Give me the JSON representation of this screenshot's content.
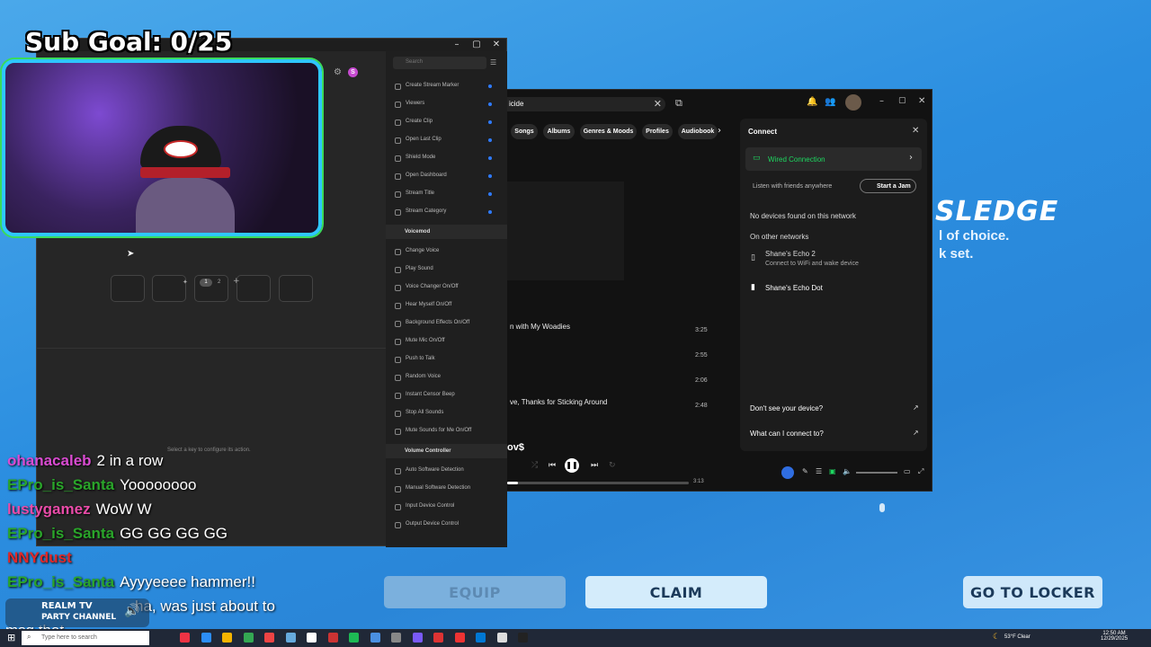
{
  "overlay": {
    "sub_goal": "Sub Goal: 0/25"
  },
  "game": {
    "item_name": "SLEDGE",
    "line1": "l of choice.",
    "line2": "k set.",
    "equip": "EQUIP",
    "claim": "CLAIM",
    "go_to_locker": "GO TO LOCKER"
  },
  "streamdeck": {
    "search_placeholder": "Search",
    "page_numbers": [
      "1",
      "2"
    ],
    "footer_hint": "Select a key to configure its action.",
    "actions_twitch": [
      "Create Stream Marker",
      "Viewers",
      "Create Clip",
      "Open Last Clip",
      "Shield Mode",
      "Open Dashboard",
      "Stream Title",
      "Stream Category"
    ],
    "category_voicemod": "Voicemod",
    "actions_voicemod": [
      "Change Voice",
      "Play Sound",
      "Voice Changer On/Off",
      "Hear Myself On/Off",
      "Background Effects On/Off",
      "Mute Mic On/Off",
      "Push to Talk",
      "Random Voice",
      "Instant Censor Beep",
      "Stop All Sounds",
      "Mute Sounds for Me On/Off"
    ],
    "category_volume": "Volume Controller",
    "actions_volume": [
      "Auto Software Detection",
      "Manual Software Detection",
      "Input Device Control",
      "Output Device Control"
    ]
  },
  "spotify": {
    "search_value": "icide",
    "chips": [
      "Songs",
      "Albums",
      "Genres & Moods",
      "Profiles",
      "Audiobook"
    ],
    "tracks": [
      {
        "title": "n with My Woadies",
        "duration": "3:25"
      },
      {
        "title": "",
        "duration": "2:55"
      },
      {
        "title": "",
        "duration": "2:06"
      },
      {
        "title": "ve, Thanks for Sticking Around",
        "duration": "2:48"
      }
    ],
    "now_playing_fragment": "ov$",
    "elapsed": "3:13",
    "connect": {
      "title": "Connect",
      "wired": "Wired Connection",
      "listen_with_friends": "Listen with friends anywhere",
      "start_jam": "Start a Jam",
      "no_devices": "No devices found on this network",
      "other_networks": "On other networks",
      "device1_name": "Shane's Echo 2",
      "device1_sub": "Connect to WiFi and wake device",
      "device2_name": "Shane's Echo Dot",
      "help1": "Don't see your device?",
      "help2": "What can I connect to?"
    }
  },
  "chat": [
    {
      "user": "ohanacaleb",
      "color": "#d94bd1",
      "msg": "2 in a row"
    },
    {
      "user": "EPro_is_Santa",
      "color": "#2aa52a",
      "msg": "Yoooooooo"
    },
    {
      "user": "lustygamez",
      "color": "#e94ba8",
      "msg": "WoW W"
    },
    {
      "user": "EPro_is_Santa",
      "color": "#2aa52a",
      "msg": "GG GG GG GG"
    },
    {
      "user": "NNYdust",
      "color": "#e02828",
      "msg": ""
    },
    {
      "user": "EPro_is_Santa",
      "color": "#2aa52a",
      "msg": "Ayyyeeee hammer!!"
    },
    {
      "user": "",
      "color": "#2aa52a",
      "msg": "ha, was just about to"
    },
    {
      "user": "",
      "color": "#ffffff",
      "msg": "msg that"
    }
  ],
  "party_channel": {
    "line1": "REALM TV",
    "line2": "PARTY CHANNEL"
  },
  "taskbar": {
    "search_placeholder": "Type here to search",
    "weather": "53°F  Clear",
    "time": "12:50 AM",
    "date": "12/29/2025"
  }
}
